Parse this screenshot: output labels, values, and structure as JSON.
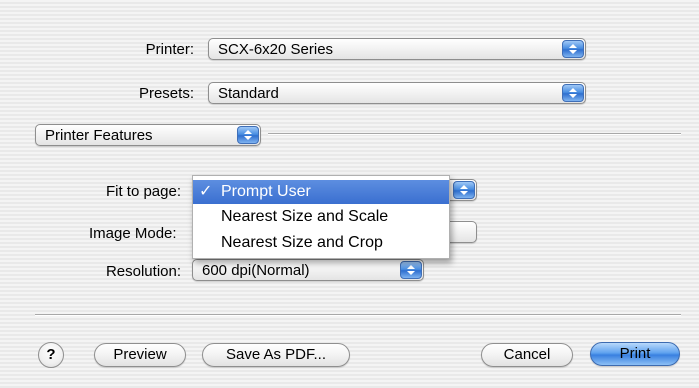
{
  "printer": {
    "label": "Printer:",
    "value": "SCX-6x20 Series"
  },
  "presets": {
    "label": "Presets:",
    "value": "Standard"
  },
  "panel": {
    "value": "Printer Features"
  },
  "fit_to_page": {
    "label": "Fit to page:",
    "menu": [
      {
        "label": "Prompt User",
        "selected": true,
        "check": "✓"
      },
      {
        "label": "Nearest Size and Scale",
        "selected": false,
        "check": ""
      },
      {
        "label": "Nearest Size and Crop",
        "selected": false,
        "check": ""
      }
    ]
  },
  "image_mode": {
    "label": "Image Mode:"
  },
  "resolution": {
    "label": "Resolution:",
    "value": "600 dpi(Normal)"
  },
  "buttons": {
    "help": "?",
    "preview": "Preview",
    "save_pdf": "Save As PDF...",
    "cancel": "Cancel",
    "print": "Print"
  },
  "colors": {
    "accent": "#3a6fd0",
    "default_button": "#5fa2ef"
  }
}
